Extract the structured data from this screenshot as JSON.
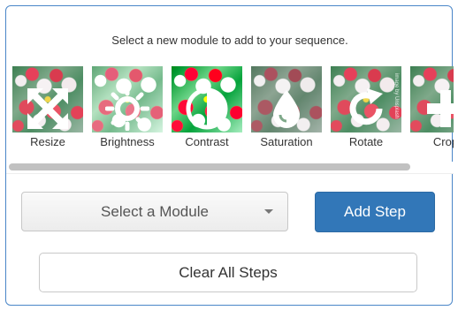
{
  "instruction": "Select a new module to add to your sequence.",
  "modules": [
    {
      "label": "Resize",
      "icon": "resize-arrows-icon",
      "watermark": ""
    },
    {
      "label": "Brightness",
      "icon": "brightness-sun-icon",
      "watermark": ""
    },
    {
      "label": "Contrast",
      "icon": "contrast-circle-icon",
      "watermark": ""
    },
    {
      "label": "Saturation",
      "icon": "saturation-drop-icon",
      "watermark": ""
    },
    {
      "label": "Rotate",
      "icon": "rotate-arrow-icon",
      "watermark": "image by Unsplash"
    },
    {
      "label": "Crop",
      "icon": "crop-plus-icon",
      "watermark": ""
    }
  ],
  "module_select": {
    "value": "Select a Module"
  },
  "add_step_label": "Add Step",
  "clear_all_label": "Clear All Steps",
  "colors": {
    "accent": "#3277b8",
    "panel_border": "#4a86c8",
    "icon": "#ffffff"
  }
}
